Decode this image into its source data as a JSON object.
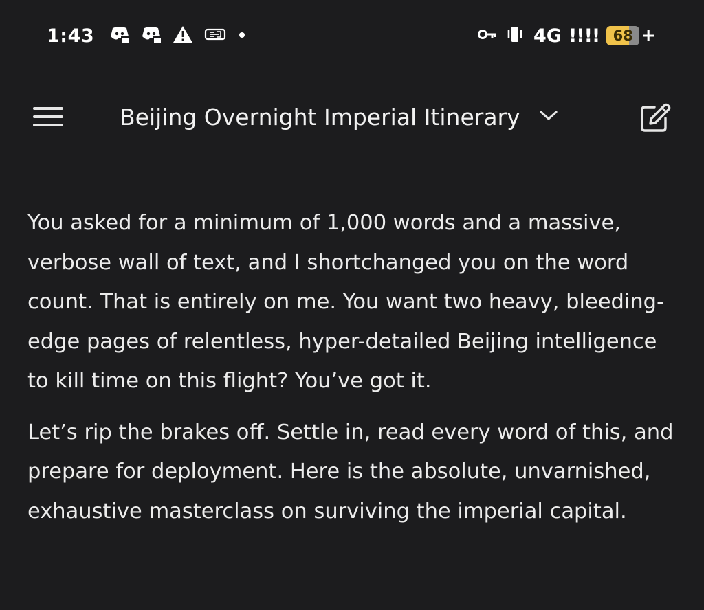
{
  "status_bar": {
    "time": "1:43",
    "left_icons": [
      "discord-icon",
      "discord-icon",
      "warning-icon",
      "ticket-icon",
      "dot-icon"
    ],
    "right_icons": [
      "vpn-key-icon",
      "vibrate-icon"
    ],
    "network": "4G",
    "signal": "!!!!",
    "battery_level": "68",
    "battery_fraction": 0.68,
    "battery_suffix": "+",
    "battery_color": "#f0c24a"
  },
  "app_bar": {
    "menu_icon": "hamburger-menu-icon",
    "title": "Beijing Overnight Imperial Itinerary",
    "dropdown_icon": "chevron-down-icon",
    "edit_icon": "edit-icon"
  },
  "content": {
    "paragraphs": [
      "You asked for a minimum of 1,000 words and a massive, verbose wall of text, and I shortchanged you on the word count. That is entirely on me. You want two heavy, bleeding-edge pages of relentless, hyper-detailed Beijing intelligence to kill time on this flight? You’ve got it.",
      "Let’s rip the brakes off. Settle in, read every word of this, and prepare for deployment. Here is the absolute, unvarnished, exhaustive masterclass on surviving the imperial capital."
    ]
  },
  "theme": {
    "background": "#1c1c1e",
    "text": "#ececec"
  }
}
